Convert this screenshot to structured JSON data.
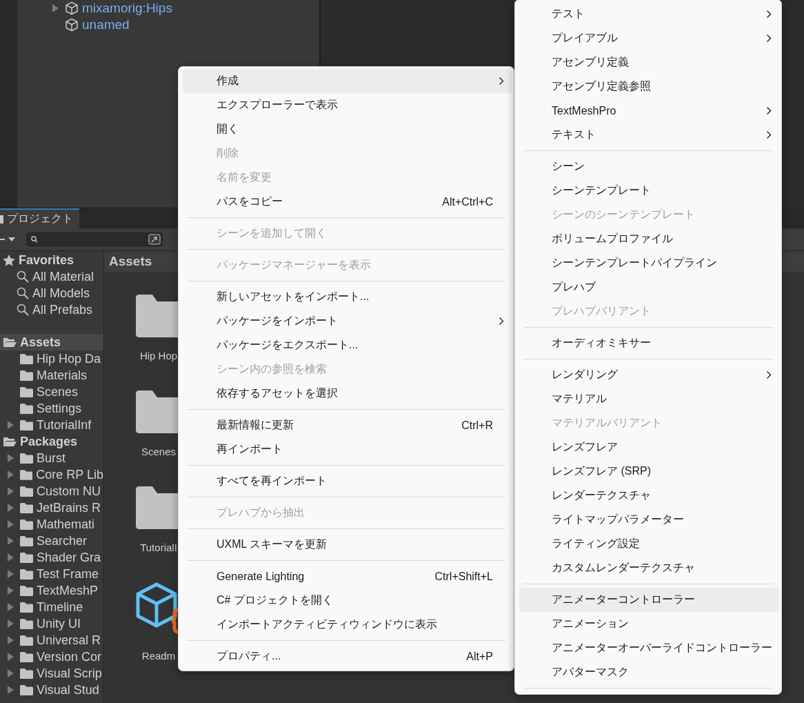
{
  "hierarchy": {
    "items": [
      {
        "label": "mixamorig:Hips",
        "has_children": true
      },
      {
        "label": "unamed",
        "has_children": false
      }
    ]
  },
  "project": {
    "tab": "プロジェクト",
    "favorites": {
      "label": "Favorites",
      "items": [
        "All Material",
        "All Models",
        "All Prefabs"
      ]
    },
    "folders": [
      {
        "label": "Assets",
        "selected": true,
        "items": [
          {
            "label": "Hip Hop Da",
            "has_children": false
          },
          {
            "label": "Materials",
            "has_children": false
          },
          {
            "label": "Scenes",
            "has_children": false
          },
          {
            "label": "Settings",
            "has_children": false
          },
          {
            "label": "TutorialInf",
            "has_children": true
          }
        ]
      },
      {
        "label": "Packages",
        "selected": false,
        "items": [
          {
            "label": "Burst",
            "has_children": true
          },
          {
            "label": "Core RP Lib",
            "has_children": true
          },
          {
            "label": "Custom NU",
            "has_children": true
          },
          {
            "label": "JetBrains R",
            "has_children": true
          },
          {
            "label": "Mathemati",
            "has_children": true
          },
          {
            "label": "Searcher",
            "has_children": true
          },
          {
            "label": "Shader Gra",
            "has_children": true
          },
          {
            "label": "Test Frame",
            "has_children": true
          },
          {
            "label": "TextMeshP",
            "has_children": true
          },
          {
            "label": "Timeline",
            "has_children": true
          },
          {
            "label": "Unity UI",
            "has_children": true
          },
          {
            "label": "Universal R",
            "has_children": true
          },
          {
            "label": "Version Cor",
            "has_children": true
          },
          {
            "label": "Visual Scrip",
            "has_children": true
          },
          {
            "label": "Visual Stud",
            "has_children": true
          }
        ]
      }
    ],
    "grid": {
      "title": "Assets",
      "items": [
        {
          "label": "Hip Hop",
          "kind": "folder"
        },
        {
          "label": "Scenes",
          "kind": "folder"
        },
        {
          "label": "TutorialI",
          "kind": "folder"
        },
        {
          "label": "Readm",
          "kind": "script"
        }
      ]
    }
  },
  "context_menu": {
    "items": [
      {
        "kind": "item",
        "label": "作成",
        "selected": true,
        "disabled": false,
        "has_submenu": true
      },
      {
        "kind": "item",
        "label": "エクスプローラーで表示",
        "selected": false,
        "disabled": false,
        "has_submenu": false
      },
      {
        "kind": "item",
        "label": "開く",
        "selected": false,
        "disabled": false,
        "has_submenu": false
      },
      {
        "kind": "item",
        "label": "削除",
        "selected": false,
        "disabled": true,
        "has_submenu": false
      },
      {
        "kind": "item",
        "label": "名前を変更",
        "selected": false,
        "disabled": true,
        "has_submenu": false
      },
      {
        "kind": "item",
        "label": "パスをコピー",
        "shortcut": "Alt+Ctrl+C",
        "selected": false,
        "disabled": false,
        "has_submenu": false
      },
      {
        "kind": "separator"
      },
      {
        "kind": "item",
        "label": "シーンを追加して開く",
        "selected": false,
        "disabled": true,
        "has_submenu": false
      },
      {
        "kind": "separator"
      },
      {
        "kind": "item",
        "label": "パッケージマネージャーを表示",
        "selected": false,
        "disabled": true,
        "has_submenu": false
      },
      {
        "kind": "separator"
      },
      {
        "kind": "item",
        "label": "新しいアセットをインポート...",
        "selected": false,
        "disabled": false,
        "has_submenu": false
      },
      {
        "kind": "item",
        "label": "パッケージをインポート",
        "selected": false,
        "disabled": false,
        "has_submenu": true
      },
      {
        "kind": "item",
        "label": "パッケージをエクスポート...",
        "selected": false,
        "disabled": false,
        "has_submenu": false
      },
      {
        "kind": "item",
        "label": "シーン内の参照を検索",
        "selected": false,
        "disabled": true,
        "has_submenu": false
      },
      {
        "kind": "item",
        "label": "依存するアセットを選択",
        "selected": false,
        "disabled": false,
        "has_submenu": false
      },
      {
        "kind": "separator"
      },
      {
        "kind": "item",
        "label": "最新情報に更新",
        "shortcut": "Ctrl+R",
        "selected": false,
        "disabled": false,
        "has_submenu": false
      },
      {
        "kind": "item",
        "label": "再インポート",
        "selected": false,
        "disabled": false,
        "has_submenu": false
      },
      {
        "kind": "separator"
      },
      {
        "kind": "item",
        "label": "すべてを再インポート",
        "selected": false,
        "disabled": false,
        "has_submenu": false
      },
      {
        "kind": "separator"
      },
      {
        "kind": "item",
        "label": "プレハブから抽出",
        "selected": false,
        "disabled": true,
        "has_submenu": false
      },
      {
        "kind": "separator"
      },
      {
        "kind": "item",
        "label": "UXML スキーマを更新",
        "selected": false,
        "disabled": false,
        "has_submenu": false
      },
      {
        "kind": "separator"
      },
      {
        "kind": "item",
        "label": "Generate Lighting",
        "shortcut": "Ctrl+Shift+L",
        "selected": false,
        "disabled": false,
        "has_submenu": false
      },
      {
        "kind": "item",
        "label": "C# プロジェクトを開く",
        "selected": false,
        "disabled": false,
        "has_submenu": false
      },
      {
        "kind": "item",
        "label": "インポートアクティビティウィンドウに表示",
        "selected": false,
        "disabled": false,
        "has_submenu": false
      },
      {
        "kind": "separator"
      },
      {
        "kind": "item",
        "label": "プロパティ...",
        "shortcut": "Alt+P",
        "selected": false,
        "disabled": false,
        "has_submenu": false
      }
    ]
  },
  "submenu": {
    "items": [
      {
        "kind": "item",
        "label": "テスト",
        "selected": false,
        "disabled": false,
        "has_submenu": true
      },
      {
        "kind": "item",
        "label": "プレイアブル",
        "selected": false,
        "disabled": false,
        "has_submenu": true
      },
      {
        "kind": "item",
        "label": "アセンブリ定義",
        "selected": false,
        "disabled": false,
        "has_submenu": false
      },
      {
        "kind": "item",
        "label": "アセンブリ定義参照",
        "selected": false,
        "disabled": false,
        "has_submenu": false
      },
      {
        "kind": "item",
        "label": "TextMeshPro",
        "selected": false,
        "disabled": false,
        "has_submenu": true
      },
      {
        "kind": "item",
        "label": "テキスト",
        "selected": false,
        "disabled": false,
        "has_submenu": true
      },
      {
        "kind": "separator"
      },
      {
        "kind": "item",
        "label": "シーン",
        "selected": false,
        "disabled": false,
        "has_submenu": false
      },
      {
        "kind": "item",
        "label": "シーンテンプレート",
        "selected": false,
        "disabled": false,
        "has_submenu": false
      },
      {
        "kind": "item",
        "label": "シーンのシーンテンプレート",
        "selected": false,
        "disabled": true,
        "has_submenu": false
      },
      {
        "kind": "item",
        "label": "ボリュームプロファイル",
        "selected": false,
        "disabled": false,
        "has_submenu": false
      },
      {
        "kind": "item",
        "label": "シーンテンプレートパイプライン",
        "selected": false,
        "disabled": false,
        "has_submenu": false
      },
      {
        "kind": "item",
        "label": "プレハブ",
        "selected": false,
        "disabled": false,
        "has_submenu": false
      },
      {
        "kind": "item",
        "label": "プレハブバリアント",
        "selected": false,
        "disabled": true,
        "has_submenu": false
      },
      {
        "kind": "separator"
      },
      {
        "kind": "item",
        "label": "オーディオミキサー",
        "selected": false,
        "disabled": false,
        "has_submenu": false
      },
      {
        "kind": "separator"
      },
      {
        "kind": "item",
        "label": "レンダリング",
        "selected": false,
        "disabled": false,
        "has_submenu": true
      },
      {
        "kind": "item",
        "label": "マテリアル",
        "selected": false,
        "disabled": false,
        "has_submenu": false
      },
      {
        "kind": "item",
        "label": "マテリアルバリアント",
        "selected": false,
        "disabled": true,
        "has_submenu": false
      },
      {
        "kind": "item",
        "label": "レンズフレア",
        "selected": false,
        "disabled": false,
        "has_submenu": false
      },
      {
        "kind": "item",
        "label": "レンズフレア (SRP)",
        "selected": false,
        "disabled": false,
        "has_submenu": false
      },
      {
        "kind": "item",
        "label": "レンダーテクスチャ",
        "selected": false,
        "disabled": false,
        "has_submenu": false
      },
      {
        "kind": "item",
        "label": "ライトマップパラメーター",
        "selected": false,
        "disabled": false,
        "has_submenu": false
      },
      {
        "kind": "item",
        "label": "ライティング設定",
        "selected": false,
        "disabled": false,
        "has_submenu": false
      },
      {
        "kind": "item",
        "label": "カスタムレンダーテクスチャ",
        "selected": false,
        "disabled": false,
        "has_submenu": false
      },
      {
        "kind": "separator"
      },
      {
        "kind": "item",
        "label": "アニメーターコントローラー",
        "selected": true,
        "disabled": false,
        "has_submenu": false
      },
      {
        "kind": "item",
        "label": "アニメーション",
        "selected": false,
        "disabled": false,
        "has_submenu": false
      },
      {
        "kind": "item",
        "label": "アニメーターオーバーライドコントローラー",
        "selected": false,
        "disabled": false,
        "has_submenu": false
      },
      {
        "kind": "item",
        "label": "アバターマスク",
        "selected": false,
        "disabled": false,
        "has_submenu": false
      },
      {
        "kind": "separator"
      }
    ]
  }
}
